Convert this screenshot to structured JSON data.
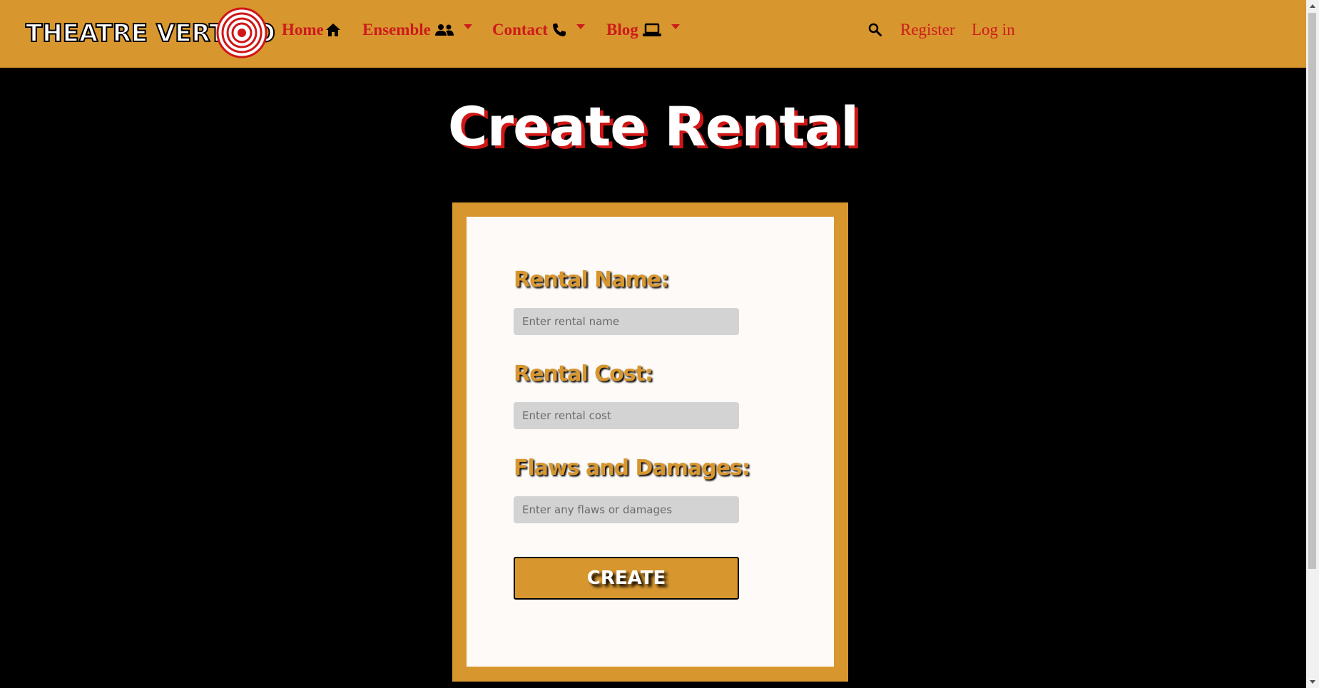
{
  "brand": {
    "logo_text": "THEATRE VERTIGO"
  },
  "nav": {
    "home": "Home",
    "ensemble": "Ensemble",
    "contact": "Contact",
    "blog": "Blog",
    "register": "Register",
    "login": "Log in"
  },
  "icons": {
    "home": "home-icon",
    "ensemble": "users-icon",
    "contact": "phone-icon",
    "blog": "laptop-icon",
    "search": "search-icon"
  },
  "colors": {
    "navbar": "#d8962f",
    "nav_link": "#cc1b1b",
    "title_shadow": "#d01616",
    "label": "#d8962f",
    "background": "#000000"
  },
  "page": {
    "title": "Create Rental"
  },
  "form": {
    "rental_name_label": "Rental Name:",
    "rental_name_placeholder": "Enter rental name",
    "rental_cost_label": "Rental Cost:",
    "rental_cost_placeholder": "Enter rental cost",
    "flaws_label": "Flaws and Damages:",
    "flaws_placeholder": "Enter any flaws or damages",
    "create_label": "CREATE"
  }
}
